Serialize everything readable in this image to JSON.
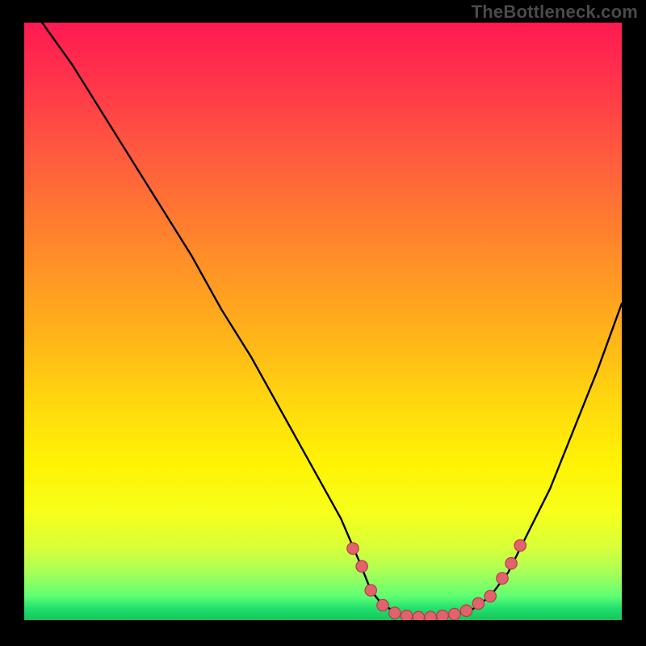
{
  "watermark": "TheBottleneck.com",
  "colors": {
    "background": "#000000",
    "curve": "#000000",
    "marker_fill": "#e0636d",
    "marker_stroke": "#b73c46",
    "gradient_top": "#ff1a52",
    "gradient_bottom": "#17c45a"
  },
  "chart_data": {
    "type": "line",
    "title": "",
    "xlabel": "",
    "ylabel": "",
    "xlim": [
      0,
      100
    ],
    "ylim": [
      0,
      100
    ],
    "grid": false,
    "legend": false,
    "note": "No axis ticks or labels are shown in the image; x/y are normalized 0–100. Curve is a bottleneck V-shape; y≈0 (green band) around x 58–78.",
    "series": [
      {
        "name": "bottleneck-curve",
        "x": [
          3,
          8,
          13,
          18,
          23,
          28,
          33,
          38,
          43,
          48,
          53,
          56,
          58,
          60,
          63,
          66,
          69,
          72,
          75,
          78,
          81,
          84,
          88,
          92,
          96,
          100
        ],
        "y": [
          100,
          93,
          85,
          77,
          69,
          61,
          52,
          44,
          35,
          26,
          17,
          10,
          5,
          2.5,
          1,
          0.5,
          0.5,
          0.8,
          1.8,
          4,
          8,
          14,
          22,
          32,
          42,
          53
        ]
      }
    ],
    "markers": {
      "name": "highlight-points",
      "note": "Pink dots clustered near the valley and along the start of the right slope.",
      "x": [
        55,
        56.5,
        58,
        60,
        62,
        64,
        66,
        68,
        70,
        72,
        74,
        76,
        78,
        80,
        81.5,
        83
      ],
      "y": [
        12,
        9,
        5,
        2.5,
        1.2,
        0.7,
        0.5,
        0.5,
        0.7,
        1,
        1.6,
        2.8,
        4,
        7,
        9.5,
        12.5
      ]
    }
  }
}
